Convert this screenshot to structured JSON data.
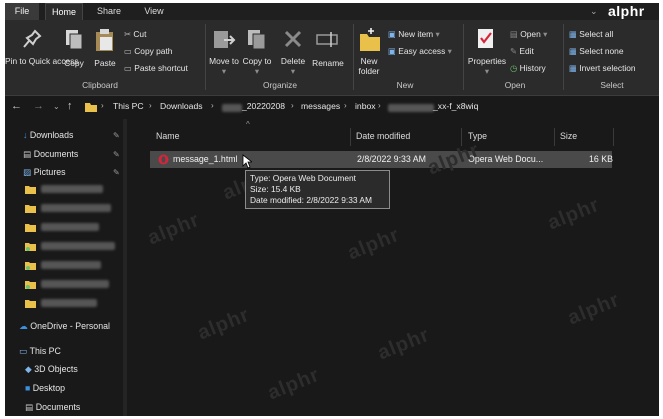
{
  "brand": "alphr",
  "tabs": [
    "File",
    "Home",
    "Share",
    "View"
  ],
  "ribbon": {
    "clipboard": {
      "pin": "Pin to Quick access",
      "copy": "Copy",
      "paste": "Paste",
      "cut": "Cut",
      "copy_path": "Copy path",
      "paste_shortcut": "Paste shortcut",
      "label": "Clipboard"
    },
    "organize": {
      "move_to": "Move to",
      "copy_to": "Copy to",
      "delete": "Delete",
      "rename": "Rename",
      "label": "Organize"
    },
    "new": {
      "new_folder": "New folder",
      "new_item": "New item",
      "easy_access": "Easy access",
      "label": "New"
    },
    "open": {
      "properties": "Properties",
      "open": "Open",
      "edit": "Edit",
      "history": "History",
      "label": "Open"
    },
    "select": {
      "select_all": "Select all",
      "select_none": "Select none",
      "invert": "Invert selection",
      "label": "Select"
    }
  },
  "address": {
    "this_pc": "This PC",
    "downloads": "Downloads",
    "folder1_suffix": "_20220208",
    "messages": "messages",
    "inbox": "inbox",
    "folder2_suffix": "_xx-f_x8wiq"
  },
  "nav": {
    "downloads": "Downloads",
    "documents": "Documents",
    "pictures": "Pictures",
    "onedrive": "OneDrive - Personal",
    "this_pc": "This PC",
    "objects3d": "3D Objects",
    "desktop": "Desktop",
    "documents2": "Documents"
  },
  "columns": {
    "name": "Name",
    "date": "Date modified",
    "type": "Type",
    "size": "Size"
  },
  "files": [
    {
      "name": "message_1.html",
      "date": "2/8/2022 9:33 AM",
      "type": "Opera Web Docu...",
      "size": "16 KB"
    }
  ],
  "tooltip": {
    "type": "Type: Opera Web Document",
    "size": "Size: 15.4 KB",
    "date": "Date modified: 2/8/2022 9:33 AM"
  },
  "watermark": "alphr",
  "colors": {
    "window_bg": "#191919",
    "ribbon_bg": "#2b2b2b",
    "selected_row": "#4a4a4a",
    "folder": "#e8c04a",
    "opera_red": "#d6253b",
    "accent_blue": "#3b8fe0"
  }
}
